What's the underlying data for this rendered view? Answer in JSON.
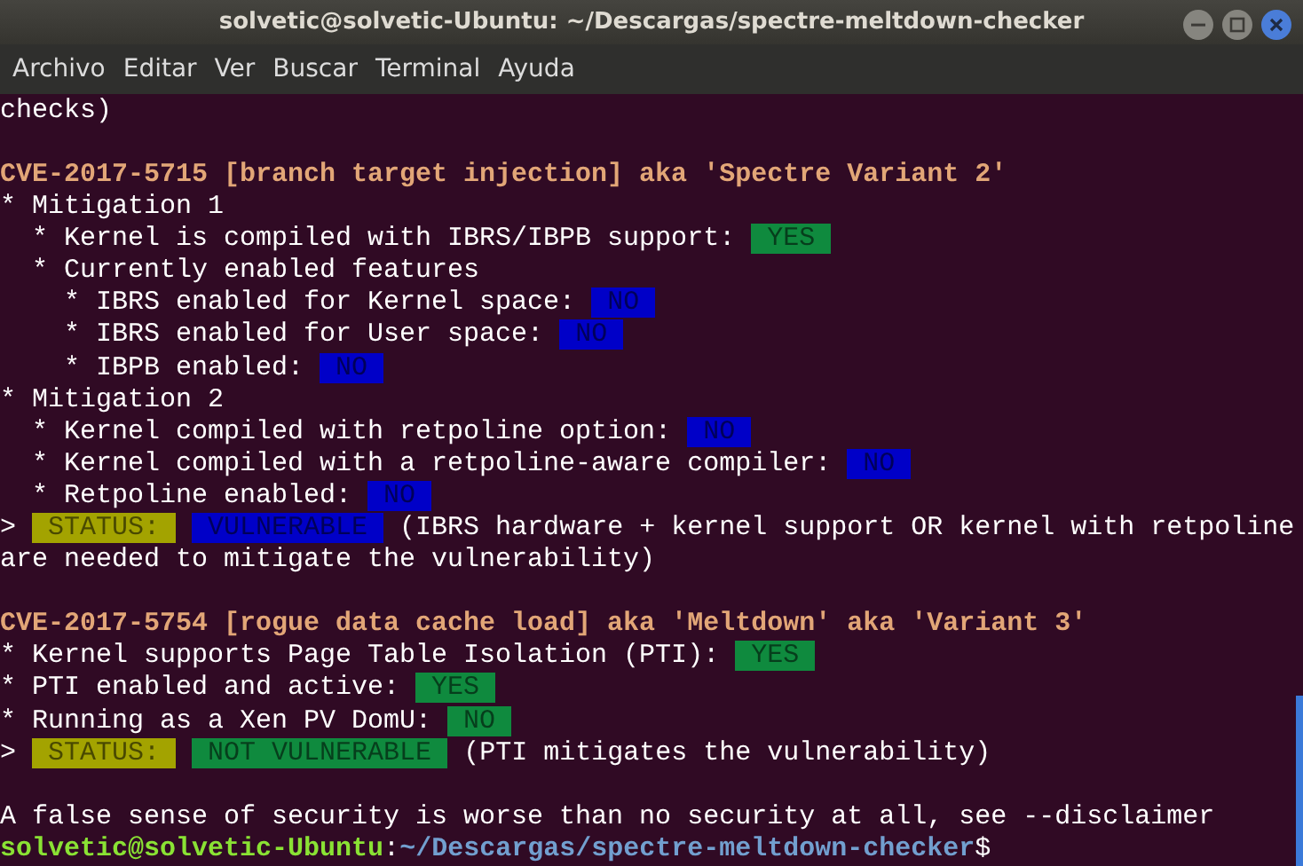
{
  "window": {
    "title": "solvetic@solvetic-Ubuntu: ~/Descargas/spectre-meltdown-checker"
  },
  "menu": [
    "Archivo",
    "Editar",
    "Ver",
    "Buscar",
    "Terminal",
    "Ayuda"
  ],
  "terminal": {
    "blocks": [
      [
        [
          {
            "kind": "plain",
            "text": "checks)"
          }
        ]
      ],
      [
        [
          {
            "kind": "heading",
            "text": "CVE-2017-5715 [branch target injection] aka 'Spectre Variant 2'"
          }
        ],
        [
          {
            "kind": "plain",
            "text": "* Mitigation 1"
          }
        ],
        [
          {
            "kind": "plain",
            "text": "  * Kernel is compiled with IBRS/IBPB support: "
          },
          {
            "kind": "badge",
            "text": "YES",
            "color": "#0f8a3e"
          }
        ],
        [
          {
            "kind": "plain",
            "text": "  * Currently enabled features"
          }
        ],
        [
          {
            "kind": "plain",
            "text": "    * IBRS enabled for Kernel space: "
          },
          {
            "kind": "badge",
            "text": "NO",
            "color": "#0000c8"
          }
        ],
        [
          {
            "kind": "plain",
            "text": "    * IBRS enabled for User space: "
          },
          {
            "kind": "badge",
            "text": "NO",
            "color": "#0000c8"
          }
        ],
        [
          {
            "kind": "plain",
            "text": "    * IBPB enabled: "
          },
          {
            "kind": "badge",
            "text": "NO",
            "color": "#0000c8"
          }
        ],
        [
          {
            "kind": "plain",
            "text": "* Mitigation 2"
          }
        ],
        [
          {
            "kind": "plain",
            "text": "  * Kernel compiled with retpoline option: "
          },
          {
            "kind": "badge",
            "text": "NO",
            "color": "#0000c8"
          }
        ],
        [
          {
            "kind": "plain",
            "text": "  * Kernel compiled with a retpoline-aware compiler: "
          },
          {
            "kind": "badge",
            "text": "NO",
            "color": "#0000c8"
          }
        ],
        [
          {
            "kind": "plain",
            "text": "  * Retpoline enabled: "
          },
          {
            "kind": "badge",
            "text": "NO",
            "color": "#0000c8"
          }
        ],
        [
          {
            "kind": "plain",
            "text": "> "
          },
          {
            "kind": "badge",
            "text": "STATUS:",
            "color": "#a3a300"
          },
          {
            "kind": "badge",
            "text": "VULNERABLE",
            "color": "#0000c8"
          },
          {
            "kind": "plain",
            "text": " (IBRS hardware + kernel support OR kernel with retpoline"
          }
        ],
        [
          {
            "kind": "plain",
            "text": "are needed to mitigate the vulnerability)"
          }
        ]
      ],
      [
        [
          {
            "kind": "heading",
            "text": "CVE-2017-5754 [rogue data cache load] aka 'Meltdown' aka 'Variant 3'"
          }
        ],
        [
          {
            "kind": "plain",
            "text": "* Kernel supports Page Table Isolation (PTI): "
          },
          {
            "kind": "badge",
            "text": "YES",
            "color": "#0f8a3e"
          }
        ],
        [
          {
            "kind": "plain",
            "text": "* PTI enabled and active: "
          },
          {
            "kind": "badge",
            "text": "YES",
            "color": "#0f8a3e"
          }
        ],
        [
          {
            "kind": "plain",
            "text": "* Running as a Xen PV DomU: "
          },
          {
            "kind": "badge",
            "text": "NO",
            "color": "#0f8a3e"
          }
        ],
        [
          {
            "kind": "plain",
            "text": "> "
          },
          {
            "kind": "badge",
            "text": "STATUS:",
            "color": "#a3a300"
          },
          {
            "kind": "badge",
            "text": "NOT VULNERABLE",
            "color": "#0f8a3e"
          },
          {
            "kind": "plain",
            "text": " (PTI mitigates the vulnerability)"
          }
        ]
      ],
      [
        [
          {
            "kind": "plain",
            "text": "A false sense of security is worse than no security at all, see --disclaimer"
          }
        ],
        [
          {
            "kind": "user",
            "text": "solvetic@solvetic-Ubuntu"
          },
          {
            "kind": "plain",
            "text": ":"
          },
          {
            "kind": "path",
            "text": "~/Descargas/spectre-meltdown-checker"
          },
          {
            "kind": "plain",
            "text": "$"
          }
        ]
      ]
    ]
  }
}
